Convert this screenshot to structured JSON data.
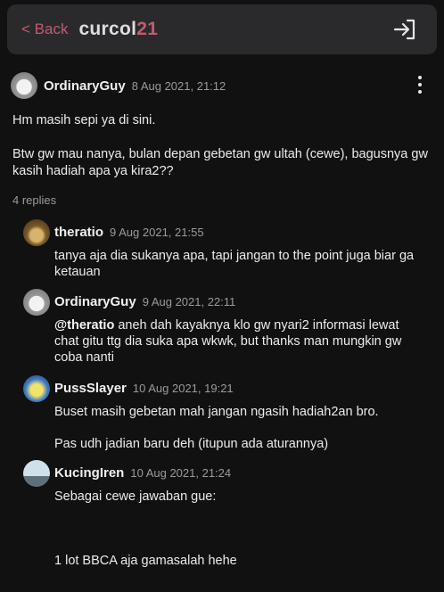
{
  "header": {
    "back_label": "< Back",
    "logo_main": "curcol",
    "logo_accent": "21"
  },
  "post": {
    "author": "OrdinaryGuy",
    "date": "8 Aug 2021, 21:12",
    "body": [
      "Hm masih sepi ya di sini.",
      "Btw gw mau nanya, bulan depan gebetan gw ultah (cewe), bagusnya gw kasih hadiah apa ya kira2??"
    ],
    "replies_label": "4 replies"
  },
  "replies": [
    {
      "author": "theratio",
      "date": "9 Aug 2021, 21:55",
      "body": [
        "tanya aja dia sukanya apa, tapi jangan to the point juga biar ga ketauan"
      ]
    },
    {
      "author": "OrdinaryGuy",
      "date": "9 Aug 2021, 22:11",
      "mention": "@theratio",
      "body": [
        " aneh dah kayaknya klo gw nyari2 informasi lewat chat gitu ttg dia suka apa wkwk, but thanks man mungkin gw coba nanti"
      ]
    },
    {
      "author": "PussSlayer",
      "date": "10 Aug 2021, 19:21",
      "body": [
        "Buset masih gebetan mah jangan ngasih hadiah2an bro.",
        "Pas udh jadian baru deh (itupun ada aturannya)"
      ]
    },
    {
      "author": "KucingIren",
      "date": "10 Aug 2021, 21:24",
      "body": [
        "Sebagai cewe jawaban gue:",
        "1 lot BBCA aja gamasalah hehe"
      ]
    }
  ],
  "colors": {
    "accent": "#c55a6e",
    "background": "#111111",
    "header_bg": "#2a2a2c",
    "muted_text": "#9b9b9b"
  },
  "icons": {
    "login": "login-arrow-icon",
    "menu": "more-vertical-icon"
  }
}
